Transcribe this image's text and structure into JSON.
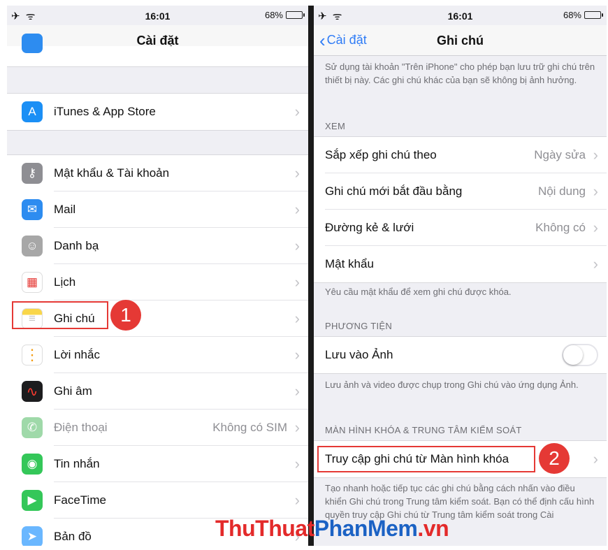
{
  "left": {
    "status": {
      "icons": "✈ ᯤ",
      "time": "16:01",
      "battery": "68%"
    },
    "title": "Cài đặt",
    "items": [
      {
        "label": "iTunes & App Store",
        "icon": "app-store-icon",
        "color": "#1b8ff5",
        "glyph": "A"
      },
      {
        "label": "Mật khẩu & Tài khoản",
        "icon": "key-icon",
        "color": "#8e8e93",
        "glyph": "⚷"
      },
      {
        "label": "Mail",
        "icon": "mail-icon",
        "color": "#2d8cf0",
        "glyph": "✉"
      },
      {
        "label": "Danh bạ",
        "icon": "contacts-icon",
        "color": "#a7a7a7",
        "glyph": "☺"
      },
      {
        "label": "Lịch",
        "icon": "calendar-icon",
        "color": "#ffffff",
        "glyph": "▦"
      },
      {
        "label": "Ghi chú",
        "icon": "notes-icon",
        "color": "#f9d649",
        "glyph": "≡"
      },
      {
        "label": "Lời nhắc",
        "icon": "reminders-icon",
        "color": "#ffffff",
        "glyph": "⋮"
      },
      {
        "label": "Ghi âm",
        "icon": "voice-memos-icon",
        "color": "#1c1c1e",
        "glyph": "∿"
      },
      {
        "label": "Điện thoại",
        "value": "Không có SIM",
        "icon": "phone-icon",
        "color": "#9fd9a9",
        "glyph": "✆"
      },
      {
        "label": "Tin nhắn",
        "icon": "messages-icon",
        "color": "#34c759",
        "glyph": "◉"
      },
      {
        "label": "FaceTime",
        "icon": "facetime-icon",
        "color": "#34c759",
        "glyph": "▶"
      },
      {
        "label": "Bản đồ",
        "icon": "maps-icon",
        "color": "#6ab7ff",
        "glyph": "➤"
      }
    ],
    "callout_number": "1"
  },
  "right": {
    "status": {
      "icons": "✈ ᯤ",
      "time": "16:01",
      "battery": "68%"
    },
    "back_label": "Cài đặt",
    "title": "Ghi chú",
    "intro_text": "Sử dụng tài khoản \"Trên iPhone\" cho phép bạn lưu trữ ghi chú trên thiết bị này. Các ghi chú khác của bạn sẽ không bị ảnh hưởng.",
    "view_section": "XEM",
    "view_rows": [
      {
        "label": "Sắp xếp ghi chú theo",
        "value": "Ngày sửa"
      },
      {
        "label": "Ghi chú mới bắt đầu bằng",
        "value": "Nội dung"
      },
      {
        "label": "Đường kẻ & lưới",
        "value": "Không có"
      },
      {
        "label": "Mật khẩu",
        "value": ""
      }
    ],
    "password_note": "Yêu cầu mật khẩu để xem ghi chú được khóa.",
    "media_section": "PHƯƠNG TIỆN",
    "save_to_photos": {
      "label": "Lưu vào Ảnh",
      "on": false
    },
    "media_note": "Lưu ảnh và video được chụp trong Ghi chú vào ứng dụng Ảnh.",
    "lock_section": "MÀN HÌNH KHÓA & TRUNG TÂM KIỂM SOÁT",
    "lock_row": "Truy cập ghi chú từ Màn hình khóa",
    "lock_note": "Tạo nhanh hoặc tiếp tục các ghi chú bằng cách nhấn vào điều khiển Ghi chú trong Trung tâm kiểm soát. Bạn có thể định cấu hình quyền truy cập Ghi chú từ Trung tâm kiểm soát trong Cài",
    "callout_number": "2"
  },
  "watermark": {
    "part1": "ThuThuat",
    "part2": "PhanMem",
    "part3": ".vn"
  },
  "colors": {
    "accent": "#2f7cf6",
    "callout": "#e53935"
  }
}
